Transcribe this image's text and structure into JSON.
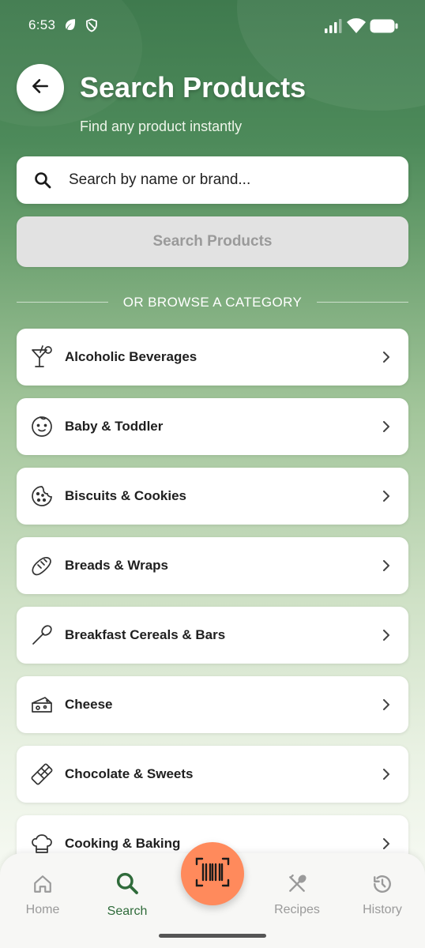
{
  "status_bar": {
    "time": "6:53",
    "left_icons": [
      "leaf-icon",
      "shield-icon"
    ],
    "right_icons": [
      "signal-icon",
      "wifi-icon",
      "battery-icon"
    ]
  },
  "header": {
    "title": "Search Products",
    "subtitle": "Find any product instantly",
    "back_icon": "arrow-left-icon"
  },
  "search": {
    "placeholder": "Search by name or brand...",
    "value": "",
    "button_label": "Search Products",
    "button_enabled": false
  },
  "divider": {
    "label": "OR BROWSE A CATEGORY"
  },
  "categories": [
    {
      "label": "Alcoholic Beverages",
      "icon": "cocktail-icon"
    },
    {
      "label": "Baby & Toddler",
      "icon": "baby-face-icon"
    },
    {
      "label": "Biscuits & Cookies",
      "icon": "cookie-icon"
    },
    {
      "label": "Breads & Wraps",
      "icon": "bread-icon"
    },
    {
      "label": "Breakfast Cereals & Bars",
      "icon": "spoon-icon"
    },
    {
      "label": "Cheese",
      "icon": "cheese-icon"
    },
    {
      "label": "Chocolate & Sweets",
      "icon": "chocolate-icon"
    },
    {
      "label": "Cooking & Baking",
      "icon": "chef-hat-icon"
    }
  ],
  "bottom_nav": {
    "items": [
      {
        "label": "Home",
        "icon": "home-icon",
        "active": false
      },
      {
        "label": "Search",
        "icon": "search-icon",
        "active": true
      },
      {
        "label": "Recipes",
        "icon": "utensils-icon",
        "active": false
      },
      {
        "label": "History",
        "icon": "history-icon",
        "active": false
      }
    ],
    "scan_icon": "barcode-scan-icon"
  },
  "colors": {
    "primary_green": "#2f6b3a",
    "header_green": "#3f7a4e",
    "scan_orange": "#ff8a5c",
    "disabled_button": "#e2e2e2"
  }
}
